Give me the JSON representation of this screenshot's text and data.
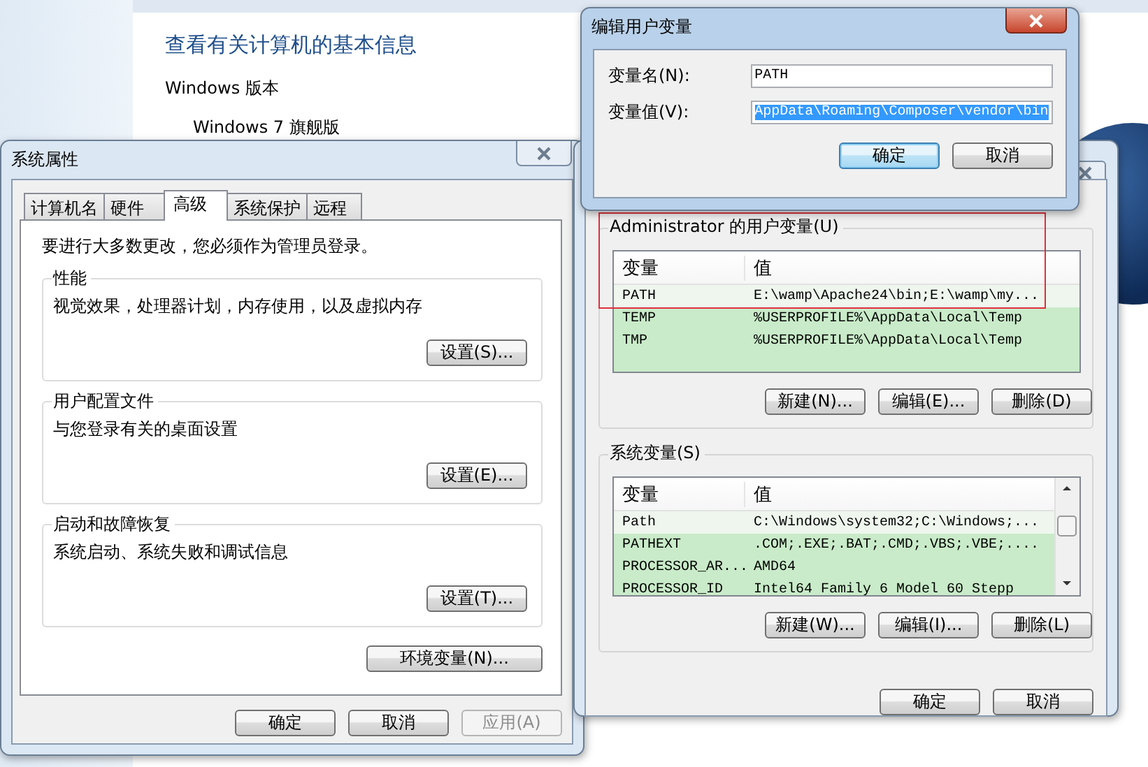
{
  "background_window": {
    "heading": "查看有关计算机的基本信息",
    "section_label": "Windows 版本",
    "edition": "Windows 7 旗舰版"
  },
  "system_properties": {
    "title": "系统属性",
    "tabs": [
      {
        "label": "计算机名",
        "selected": false
      },
      {
        "label": "硬件",
        "selected": false
      },
      {
        "label": "高级",
        "selected": true
      },
      {
        "label": "系统保护",
        "selected": false
      },
      {
        "label": "远程",
        "selected": false
      }
    ],
    "notice": "要进行大多数更改，您必须作为管理员登录。",
    "groups": [
      {
        "title": "性能",
        "description": "视觉效果，处理器计划，内存使用，以及虚拟内存",
        "button": "设置(S)..."
      },
      {
        "title": "用户配置文件",
        "description": "与您登录有关的桌面设置",
        "button": "设置(E)..."
      },
      {
        "title": "启动和故障恢复",
        "description": "系统启动、系统失败和调试信息",
        "button": "设置(T)..."
      }
    ],
    "env_button": "环境变量(N)...",
    "buttons": [
      {
        "label": "确定",
        "disabled": false
      },
      {
        "label": "取消",
        "disabled": false
      },
      {
        "label": "应用(A)",
        "disabled": true
      }
    ]
  },
  "environment_variables": {
    "groups": [
      {
        "title": "Administrator 的用户变量(U)",
        "columns": [
          "变量",
          "值"
        ],
        "rows": [
          {
            "name": "PATH",
            "value": "E:\\wamp\\Apache24\\bin;E:\\wamp\\my...",
            "highlighted": false
          },
          {
            "name": "TEMP",
            "value": "%USERPROFILE%\\AppData\\Local\\Temp",
            "highlighted": true
          },
          {
            "name": "TMP",
            "value": "%USERPROFILE%\\AppData\\Local\\Temp",
            "highlighted": true
          }
        ],
        "buttons": [
          "新建(N)...",
          "编辑(E)...",
          "删除(D)"
        ],
        "scrollable": false
      },
      {
        "title": "系统变量(S)",
        "columns": [
          "变量",
          "值"
        ],
        "rows": [
          {
            "name": "Path",
            "value": "C:\\Windows\\system32;C:\\Windows;...",
            "highlighted": false
          },
          {
            "name": "PATHEXT",
            "value": ".COM;.EXE;.BAT;.CMD;.VBS;.VBE;....",
            "highlighted": true
          },
          {
            "name": "PROCESSOR_AR...",
            "value": "AMD64",
            "highlighted": true
          },
          {
            "name": "PROCESSOR_ID",
            "value": "Intel64 Family 6 Model 60 Stepp",
            "highlighted": true
          }
        ],
        "buttons": [
          "新建(W)...",
          "编辑(I)...",
          "删除(L)"
        ],
        "scrollable": true
      }
    ],
    "buttons": [
      "确定",
      "取消"
    ]
  },
  "edit_dialog": {
    "title": "编辑用户变量",
    "fields": [
      {
        "label": "变量名(N):",
        "value": "PATH",
        "selected": false
      },
      {
        "label": "变量值(V):",
        "value": "AppData\\Roaming\\Composer\\vendor\\bin",
        "selected": true
      }
    ],
    "buttons": [
      {
        "label": "确定",
        "focused": true
      },
      {
        "label": "取消",
        "focused": false
      }
    ]
  }
}
